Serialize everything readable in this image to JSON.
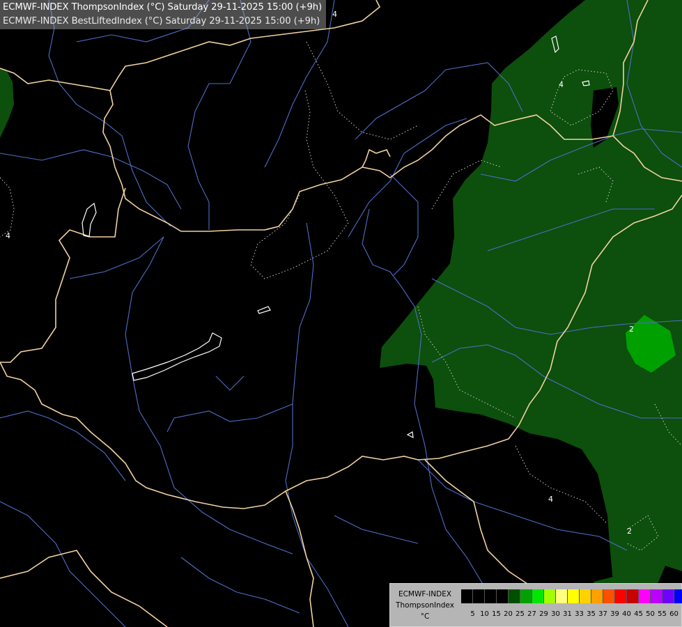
{
  "header": {
    "line1": "ECMWF-INDEX ThompsonIndex (°C) Saturday 29-11-2025 15:00 (+9h)",
    "line2": "ECMWF-INDEX BestLiftedIndex (°C) Saturday 29-11-2025 15:00 (+9h)"
  },
  "legend": {
    "title1": "ECMWF-INDEX",
    "title2": "ThompsonIndex",
    "unit": "°C",
    "colors": [
      "#000000",
      "#000000",
      "#000000",
      "#000000",
      "#004f00",
      "#00a100",
      "#00e700",
      "#a1ff00",
      "#ffff80",
      "#ffff00",
      "#ffd200",
      "#ff9f00",
      "#ff5000",
      "#ff0000",
      "#c80000",
      "#ff00ff",
      "#bb00ff",
      "#7000ff",
      "#0000ff"
    ],
    "ticks": [
      "5",
      "10",
      "15",
      "20",
      "25",
      "27",
      "29",
      "30",
      "31",
      "33",
      "35",
      "37",
      "39",
      "40",
      "45",
      "50",
      "55",
      "60"
    ]
  },
  "contour_labels": [
    "4",
    "4",
    "4",
    "2",
    "2",
    "4",
    "4"
  ],
  "colors": {
    "field_dark_green": "#0d4f0d",
    "field_mid_green": "#00a000",
    "border": "#f2d2a0",
    "river": "#4e6ec8",
    "lake": "#ffffff"
  }
}
